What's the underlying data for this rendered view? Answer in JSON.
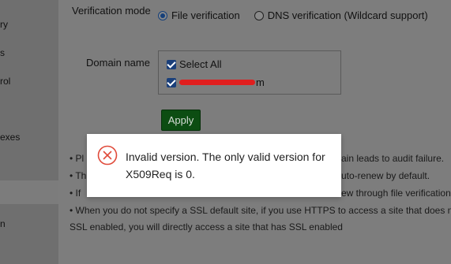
{
  "sidebar": {
    "items": [
      {
        "label": "ry"
      },
      {
        "label": "s"
      },
      {
        "label": "rol"
      },
      {
        "label": "exes"
      },
      {
        "label": "n"
      }
    ]
  },
  "form": {
    "verification_mode_label": "Verification mode",
    "options": [
      {
        "label": "File verification",
        "checked": true
      },
      {
        "label": "DNS verification (Wildcard support)",
        "checked": false
      }
    ],
    "domain_name_label": "Domain name",
    "select_all_label": "Select All",
    "domain_suffix": "m",
    "apply_label": "Apply"
  },
  "notes": {
    "line1_left": "• Pl",
    "line1_right": "ain leads to audit failure.",
    "line2_left": "• Th",
    "line2_right": "uto-renew by default.",
    "line3_left": "• If",
    "line3_right": "ew through file verification",
    "line4": "• When you do not specify a SSL default site, if you use HTTPS to access a site that does not h",
    "line5": "SSL enabled, you will directly access a site that has SSL enabled"
  },
  "dialog": {
    "message": "Invalid version. The only valid version for X509Req is 0.",
    "icon": "error-circle-x-icon",
    "icon_color": "#e04a3a"
  },
  "colors": {
    "apply_bg": "#0c4d12",
    "checkbox_bg": "#1a3f7a"
  }
}
